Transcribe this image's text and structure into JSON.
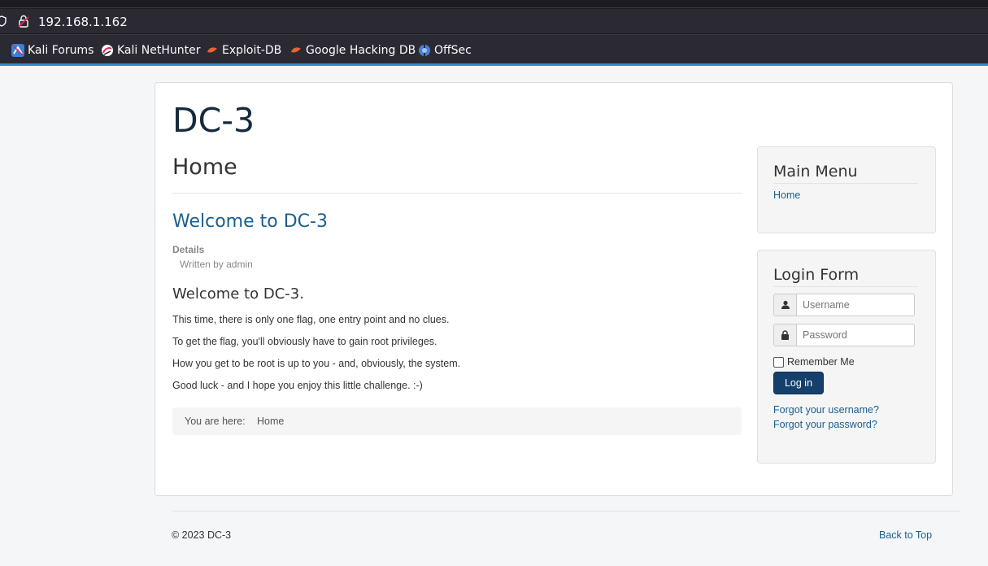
{
  "browser": {
    "url": "192.168.1.162",
    "bookmarks": [
      {
        "label": "Kali Forums",
        "icon": "kali-forums-icon"
      },
      {
        "label": "Kali NetHunter",
        "icon": "kali-nethunter-icon"
      },
      {
        "label": "Exploit-DB",
        "icon": "exploit-db-icon"
      },
      {
        "label": "Google Hacking DB",
        "icon": "google-hacking-db-icon"
      },
      {
        "label": "OffSec",
        "icon": "offsec-icon"
      }
    ]
  },
  "site": {
    "brand": "DC-3"
  },
  "main": {
    "page_heading": "Home",
    "article_title": "Welcome to DC-3",
    "details_label": "Details",
    "written_by": "Written by admin",
    "subheading": "Welcome to DC-3.",
    "paragraphs": [
      "This time, there is only one flag, one entry point and no clues.",
      "To get the flag, you'll obviously have to gain root privileges.",
      "How you get to be root is up to you - and, obviously, the system.",
      "Good luck - and I hope you enjoy this little challenge.  :-)"
    ],
    "breadcrumb": {
      "prefix": "You are here:",
      "current": "Home"
    }
  },
  "sidebar": {
    "main_menu": {
      "title": "Main Menu",
      "items": [
        "Home"
      ]
    },
    "login": {
      "title": "Login Form",
      "username_placeholder": "Username",
      "password_placeholder": "Password",
      "remember_label": "Remember Me",
      "remember_checked": false,
      "submit_label": "Log in",
      "forgot_username": "Forgot your username?",
      "forgot_password": "Forgot your password?"
    }
  },
  "footer": {
    "copyright": "© 2023 DC-3",
    "back_to_top": "Back to Top"
  },
  "colors": {
    "link": "#1a5f8f",
    "button": "#15406b",
    "browser_chrome": "#2b2a33",
    "accent": "#2a8ed6"
  }
}
